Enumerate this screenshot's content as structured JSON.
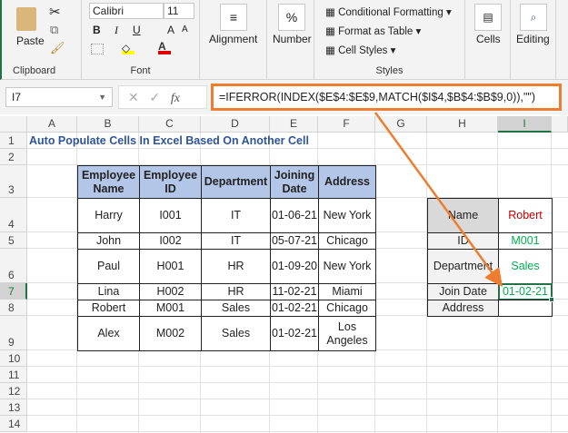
{
  "ribbon": {
    "clipboard": {
      "paste": "Paste",
      "label": "Clipboard"
    },
    "font": {
      "name": "Calibri",
      "size": "11",
      "bold": "B",
      "italic": "I",
      "underline": "U",
      "label": "Font",
      "fill_color": "#ffff00",
      "font_color": "#e00000"
    },
    "alignment": {
      "label": "Alignment"
    },
    "number": {
      "label": "Number",
      "symbol": "%"
    },
    "styles": {
      "conditional": "Conditional Formatting",
      "format_table": "Format as Table",
      "cell_styles": "Cell Styles",
      "label": "Styles"
    },
    "cells": {
      "label": "Cells"
    },
    "editing": {
      "label": "Editing"
    }
  },
  "formula_bar": {
    "name_box": "I7",
    "fx": "fx",
    "formula": "=IFERROR(INDEX($E$4:$E$9,MATCH($I$4,$B$4:$B$9,0)),\"\")"
  },
  "columns": [
    "A",
    "B",
    "C",
    "D",
    "E",
    "F",
    "G",
    "H",
    "I"
  ],
  "rows": [
    "1",
    "2",
    "3",
    "4",
    "5",
    "6",
    "7",
    "8",
    "9",
    "10",
    "11",
    "12",
    "13",
    "14"
  ],
  "title": "Auto Populate Cells In Excel Based On Another Cell",
  "main_table": {
    "headers": [
      "Employee Name",
      "Employee ID",
      "Department",
      "Joining Date",
      "Address"
    ],
    "rows": [
      [
        "Harry",
        "I001",
        "IT",
        "01-06-21",
        "New York"
      ],
      [
        "John",
        "I002",
        "IT",
        "05-07-21",
        "Chicago"
      ],
      [
        "Paul",
        "H001",
        "HR",
        "01-09-20",
        "New York"
      ],
      [
        "Lina",
        "H002",
        "HR",
        "11-02-21",
        "Miami"
      ],
      [
        "Robert",
        "M001",
        "Sales",
        "01-02-21",
        "Chicago"
      ],
      [
        "Alex",
        "M002",
        "Sales",
        "01-02-21",
        "Los Angeles"
      ]
    ]
  },
  "lookup": {
    "labels": [
      "Name",
      "ID",
      "Department",
      "Join Date",
      "Address"
    ],
    "values": [
      "Robert",
      "M001",
      "Sales",
      "01-02-21",
      ""
    ],
    "name_color": "#c00000",
    "value_color": "#00b050"
  },
  "accent": "#ed7d31"
}
